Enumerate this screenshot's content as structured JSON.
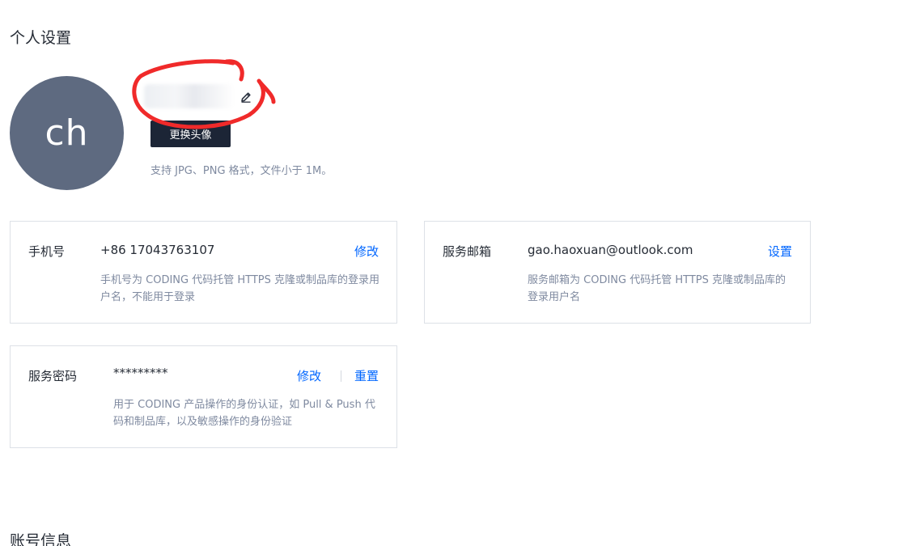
{
  "page": {
    "title": "个人设置",
    "next_section_title": "账号信息"
  },
  "profile": {
    "avatar_initials": "ch",
    "name": "",
    "change_avatar_label": "更换头像",
    "avatar_hint": "支持 JPG、PNG 格式，文件小于 1M。",
    "edit_icon": "pencil-icon",
    "annotation_color": "#f02a2a"
  },
  "phone_card": {
    "label": "手机号",
    "value": "+86 17043763107",
    "action": "修改",
    "description": "手机号为 CODING 代码托管 HTTPS 克隆或制品库的登录用户名，不能用于登录"
  },
  "email_card": {
    "label": "服务邮箱",
    "value": "gao.haoxuan@outlook.com",
    "action": "设置",
    "description": "服务邮箱为 CODING 代码托管 HTTPS 克隆或制品库的登录用户名"
  },
  "password_card": {
    "label": "服务密码",
    "value": "*********",
    "action_modify": "修改",
    "action_reset": "重置",
    "description": "用于 CODING 产品操作的身份认证，如 Pull & Push 代码和制品库，以及敏感操作的身份验证"
  },
  "colors": {
    "accent": "#0066ff",
    "avatar_bg": "#5e6a80",
    "button_bg": "#1c2536"
  }
}
